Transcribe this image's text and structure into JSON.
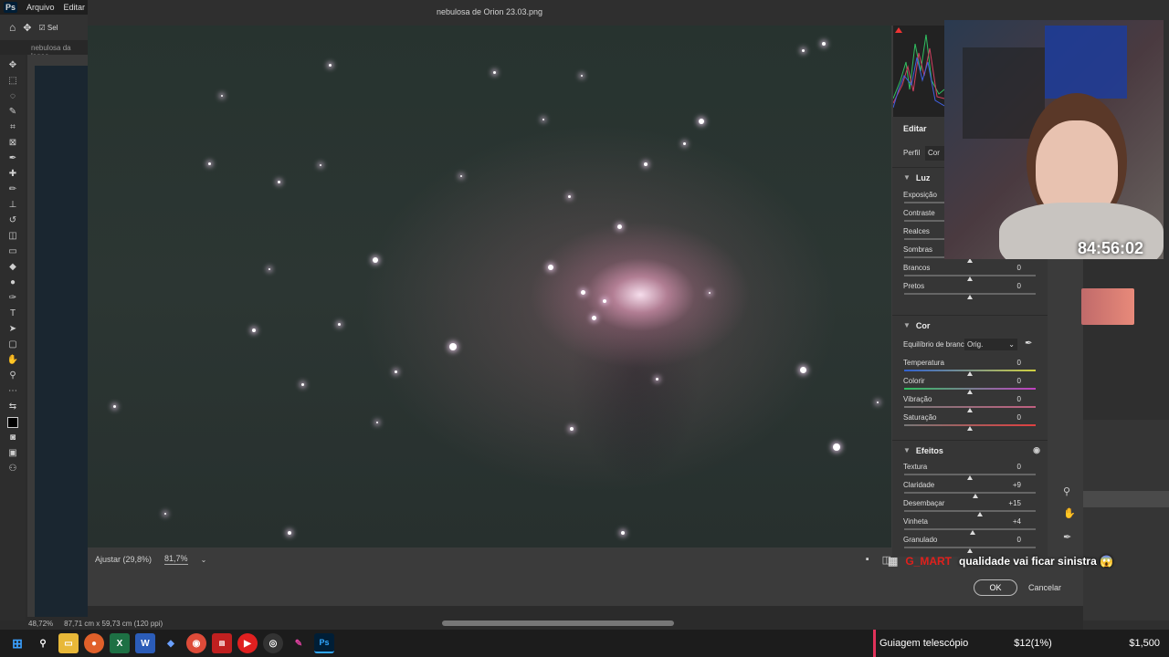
{
  "menubar": {
    "logo": "Ps",
    "items": [
      "Arquivo",
      "Editar",
      "Im"
    ]
  },
  "options": {
    "select_label": "Sel"
  },
  "doc_tab": {
    "name": "nebulosa da lagoa"
  },
  "dialog": {
    "title": "nebulosa de Orion 23.03.png",
    "fit_label": "Ajustar (29,8%)",
    "zoom_value": "81,7%",
    "ok_label": "OK",
    "cancel_label": "Cancelar"
  },
  "panel": {
    "title": "Editar",
    "profile_label": "Perfil",
    "profile_value": "Cor",
    "luz": {
      "title": "Luz",
      "rows": [
        {
          "label": "Exposição",
          "value": ""
        },
        {
          "label": "Contraste",
          "value": ""
        },
        {
          "label": "Realces",
          "value": ""
        },
        {
          "label": "Sombras",
          "value": ""
        },
        {
          "label": "Brancos",
          "value": "0"
        },
        {
          "label": "Pretos",
          "value": "0"
        }
      ]
    },
    "cor": {
      "title": "Cor",
      "wb_label": "Equilíbrio de branco",
      "wb_value": "Orig.",
      "rows": [
        {
          "label": "Temperatura",
          "value": "0"
        },
        {
          "label": "Colorir",
          "value": "0"
        },
        {
          "label": "Vibração",
          "value": "0"
        },
        {
          "label": "Saturação",
          "value": "0"
        }
      ]
    },
    "efeitos": {
      "title": "Efeitos",
      "rows": [
        {
          "label": "Textura",
          "value": "0"
        },
        {
          "label": "Claridade",
          "value": "+9"
        },
        {
          "label": "Desembaçar",
          "value": "+15"
        },
        {
          "label": "Vinheta",
          "value": "+4"
        },
        {
          "label": "Granulado",
          "value": "0"
        }
      ]
    }
  },
  "stream": {
    "timer": "84:56:02",
    "chat_user": "G_MART",
    "chat_message": "qualidade vai ficar sinistra 😱"
  },
  "statusbar": {
    "zoom": "48,72%",
    "doc_info": "87,71 cm x 59,73 cm (120 ppi)"
  },
  "taskbar": {
    "ticker_label": "Guiagem telescópio",
    "ticker_value1": "$12(1%)",
    "ticker_value2": "$1,500"
  },
  "colors": {
    "accent_red": "#e0201c",
    "ticker_bar": "#e0325a"
  }
}
